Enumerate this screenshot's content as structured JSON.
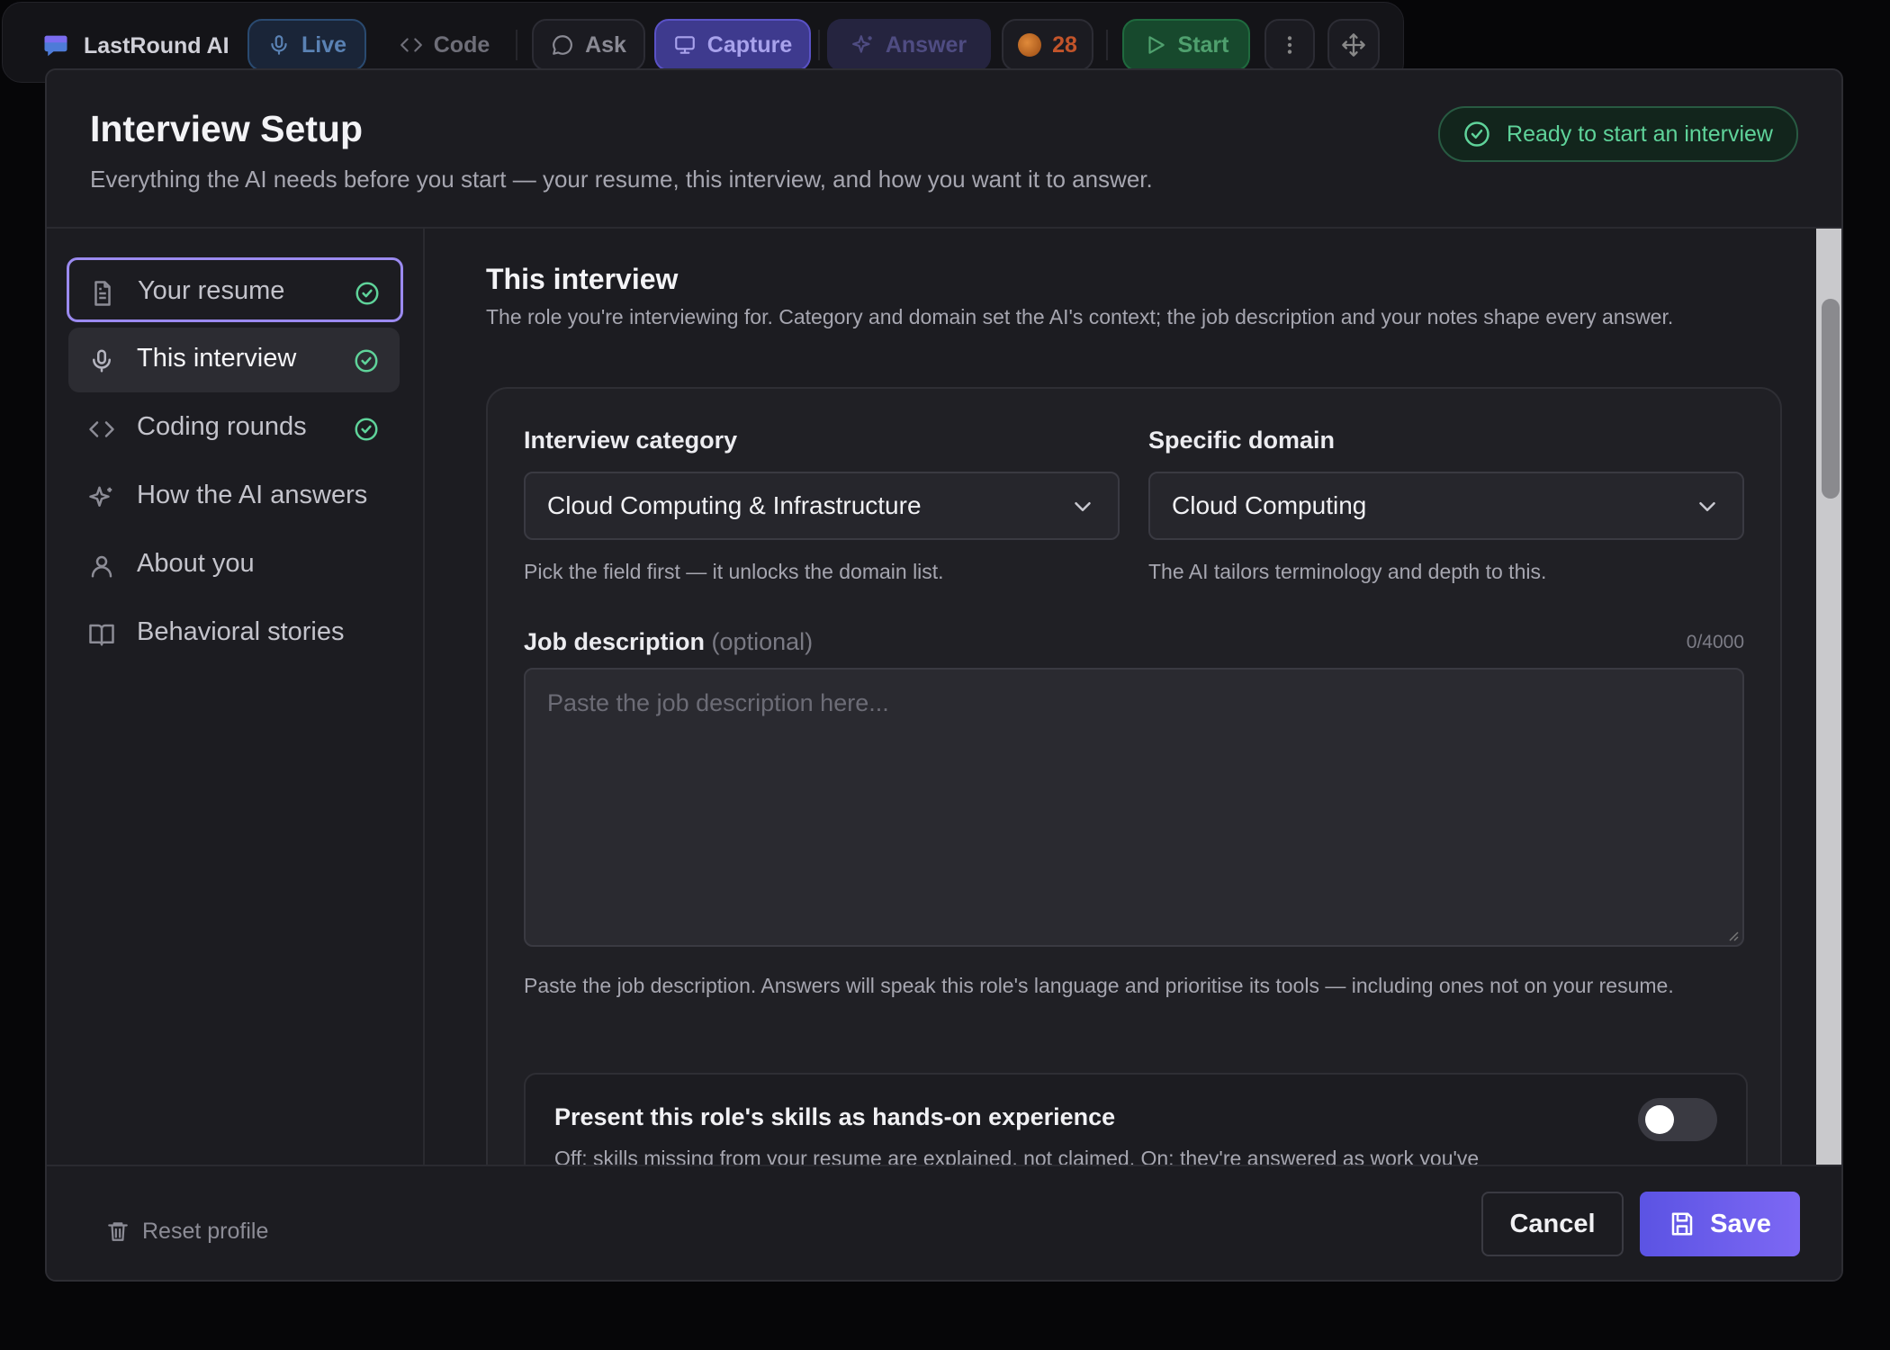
{
  "toolbar": {
    "brand": "LastRound AI",
    "live": "Live",
    "code": "Code",
    "ask": "Ask",
    "capture": "Capture",
    "answer": "Answer",
    "credits": "28",
    "start": "Start"
  },
  "modal": {
    "title": "Interview Setup",
    "subtitle": "Everything the AI needs before you start — your resume, this interview, and how you want it to answer.",
    "status_badge": "Ready to start an interview"
  },
  "sidebar": {
    "items": [
      {
        "label": "Your resume",
        "icon": "document-icon",
        "complete": true,
        "state": "focused"
      },
      {
        "label": "This interview",
        "icon": "microphone-icon",
        "complete": true,
        "state": "selected"
      },
      {
        "label": "Coding rounds",
        "icon": "code-icon",
        "complete": true,
        "state": "default"
      },
      {
        "label": "How the AI answers",
        "icon": "sparkle-icon",
        "complete": false,
        "state": "default"
      },
      {
        "label": "About you",
        "icon": "user-icon",
        "complete": false,
        "state": "default"
      },
      {
        "label": "Behavioral stories",
        "icon": "book-icon",
        "complete": false,
        "state": "default"
      }
    ]
  },
  "section": {
    "title": "This interview",
    "description": "The role you're interviewing for. Category and domain set the AI's context; the job description and your notes shape every answer.",
    "category": {
      "label": "Interview category",
      "value": "Cloud Computing & Infrastructure",
      "help": "Pick the field first — it unlocks the domain list."
    },
    "domain": {
      "label": "Specific domain",
      "value": "Cloud Computing",
      "help": "The AI tailors terminology and depth to this."
    },
    "job_description": {
      "label": "Job description",
      "optional": "(optional)",
      "counter": "0/4000",
      "placeholder": "Paste the job description here...",
      "value": "",
      "help": "Paste the job description. Answers will speak this role's language and prioritise its tools — including ones not on your resume."
    },
    "skills_toggle": {
      "title": "Present this role's skills as hands-on experience",
      "description": "Off: skills missing from your resume are explained, not claimed. On: they're answered as work you've",
      "enabled": false
    }
  },
  "footer": {
    "reset": "Reset profile",
    "cancel": "Cancel",
    "save": "Save"
  },
  "colors": {
    "accent": "#6d5ff0",
    "success": "#5fd39a",
    "background": "#1c1c21"
  }
}
